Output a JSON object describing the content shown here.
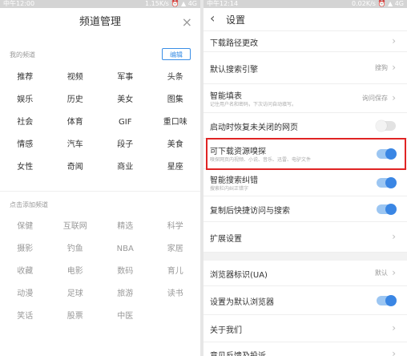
{
  "left_status": {
    "time": "中午12:00",
    "right": "1.15K/s ⏰ ▲ 4G"
  },
  "right_status": {
    "time": "中午12:14",
    "right": "0.02K/s ⏰ ▲ 4G"
  },
  "channel_manager": {
    "title": "频道管理",
    "close_icon": "×",
    "my_channels_label": "我的频道",
    "edit_label": "编辑",
    "my_channels": [
      [
        "推荐",
        "视频",
        "军事",
        "头条"
      ],
      [
        "娱乐",
        "历史",
        "美女",
        "图集"
      ],
      [
        "社会",
        "体育",
        "GIF",
        "重口味"
      ],
      [
        "情感",
        "汽车",
        "段子",
        "美食"
      ],
      [
        "女性",
        "奇闻",
        "商业",
        "星座"
      ]
    ],
    "add_label": "点击添加频道",
    "add_channels": [
      [
        "保健",
        "互联网",
        "精选",
        "科学"
      ],
      [
        "摄影",
        "钓鱼",
        "NBA",
        "家居"
      ],
      [
        "收藏",
        "电影",
        "数码",
        "育儿"
      ],
      [
        "动漫",
        "足球",
        "旅游",
        "读书"
      ],
      [
        "笑话",
        "股票",
        "中医",
        ""
      ]
    ]
  },
  "settings": {
    "back_icon": "‹",
    "title": "设置",
    "items": [
      {
        "title": "下载路径更改",
        "subtitle": "",
        "value": "",
        "control": "chevron"
      },
      {
        "title": "默认搜索引擎",
        "subtitle": "",
        "value": "搜狗",
        "control": "chevron"
      },
      {
        "title": "智能填表",
        "subtitle": "记住用户名和密码，下次访问自动填写。",
        "value": "询问保存",
        "control": "chevron"
      },
      {
        "title": "启动时恢复未关闭的网页",
        "subtitle": "",
        "value": "",
        "control": "toggle-off"
      },
      {
        "title": "可下载资源嗅探",
        "subtitle": "嗅探网页内视频、小说、音乐、迅雷、电驴文件",
        "value": "",
        "control": "toggle-on"
      },
      {
        "title": "智能搜索纠错",
        "subtitle": "搜索栏内纠正错字",
        "value": "",
        "control": "toggle-on"
      },
      {
        "title": "复制后快捷访问与搜索",
        "subtitle": "",
        "value": "",
        "control": "toggle-on"
      },
      {
        "title": "扩展设置",
        "subtitle": "",
        "value": "",
        "control": "chevron"
      },
      {
        "title": "浏览器标识(UA)",
        "subtitle": "",
        "value": "默认",
        "control": "chevron"
      },
      {
        "title": "设置为默认浏览器",
        "subtitle": "",
        "value": "",
        "control": "toggle-on"
      },
      {
        "title": "关于我们",
        "subtitle": "",
        "value": "",
        "control": "chevron"
      },
      {
        "title": "意见反馈及投诉",
        "subtitle": "",
        "value": "",
        "control": "chevron"
      }
    ],
    "chevron_icon": "›"
  },
  "colors": {
    "accent": "#3a86e4",
    "highlight": "#e02424"
  }
}
